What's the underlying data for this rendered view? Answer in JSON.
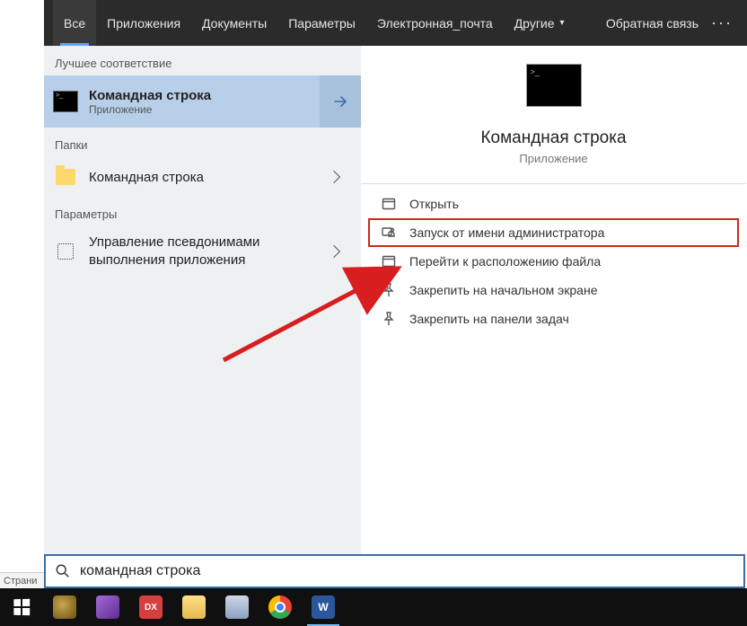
{
  "topbar": {
    "tabs": [
      {
        "label": "Все",
        "active": true
      },
      {
        "label": "Приложения"
      },
      {
        "label": "Документы"
      },
      {
        "label": "Параметры"
      },
      {
        "label": "Электронная_почта"
      },
      {
        "label": "Другие",
        "dropdown": true
      }
    ],
    "feedback": "Обратная связь"
  },
  "left": {
    "sections": {
      "best_match": "Лучшее соответствие",
      "folders": "Папки",
      "settings": "Параметры"
    },
    "best_match_item": {
      "title": "Командная строка",
      "subtitle": "Приложение"
    },
    "folder_item": {
      "title": "Командная строка"
    },
    "settings_item": {
      "title": "Управление псевдонимами выполнения приложения"
    }
  },
  "preview": {
    "title": "Командная строка",
    "subtitle": "Приложение",
    "actions": [
      {
        "label": "Открыть",
        "icon": "open"
      },
      {
        "label": "Запуск от имени администратора",
        "icon": "admin",
        "highlighted": true
      },
      {
        "label": "Перейти к расположению файла",
        "icon": "location"
      },
      {
        "label": "Закрепить на начальном экране",
        "icon": "pin-start"
      },
      {
        "label": "Закрепить на панели задач",
        "icon": "pin-taskbar"
      }
    ]
  },
  "search": {
    "value": "командная строка"
  },
  "status_fragment": "Страни",
  "taskbar": {
    "items": [
      "start",
      "app1",
      "vs",
      "dx",
      "explorer",
      "np",
      "chrome",
      "word"
    ]
  },
  "colors": {
    "accent": "#3a6ea5",
    "highlight_border": "#cc2a1f",
    "selection": "#b7cfe8"
  }
}
